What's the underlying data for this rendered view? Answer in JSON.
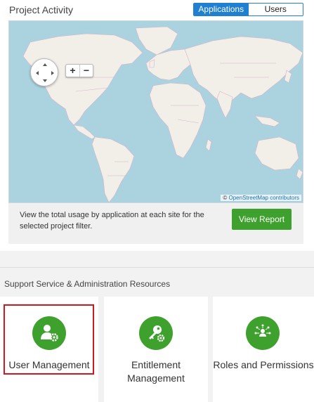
{
  "project_activity": {
    "title": "Project Activity",
    "toggle": {
      "applications": "Applications",
      "users": "Users",
      "selected": "applications"
    },
    "map": {
      "zoom_in": "+",
      "zoom_out": "−",
      "attribution_prefix": "©",
      "attribution_link": "OpenStreetMap contributors"
    },
    "report_text": "View the total usage by application at each site for the selected project filter.",
    "report_button": "View Report"
  },
  "resources": {
    "title": "Support Service & Administration Resources",
    "cards": [
      {
        "label": "User Management",
        "icon": "user-gear-icon"
      },
      {
        "label": "Entitlement Management",
        "icon": "key-gear-icon"
      },
      {
        "label": "Roles and Permissions",
        "icon": "people-network-icon"
      }
    ]
  },
  "colors": {
    "accent_blue": "#1f7fd0",
    "green": "#3fa12d",
    "highlight_red": "#d0191e",
    "ocean": "#aad3df",
    "land": "#f2efe9"
  }
}
